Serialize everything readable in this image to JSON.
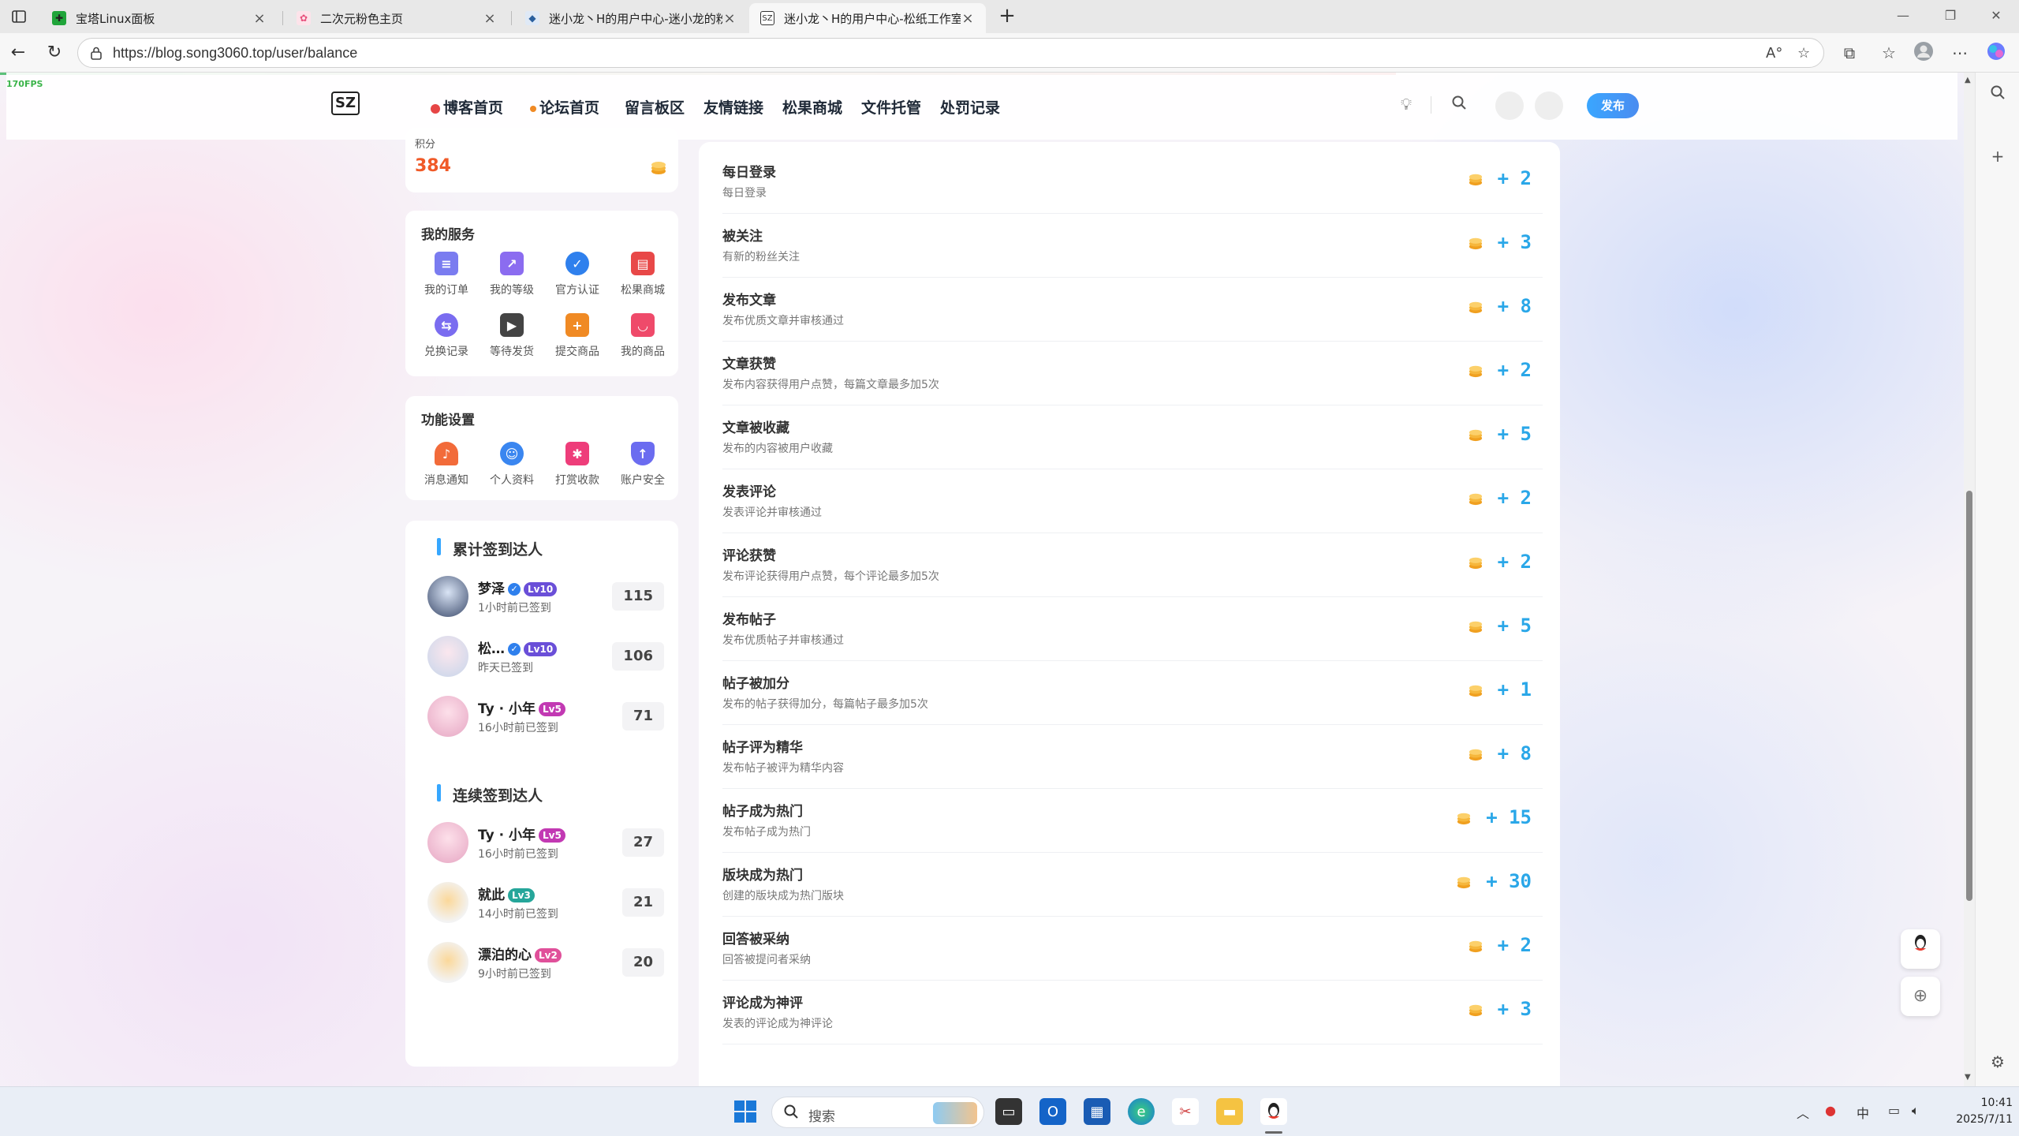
{
  "browser": {
    "tabs": [
      {
        "title": "宝塔Linux面板",
        "active": false
      },
      {
        "title": "二次元粉色主页",
        "active": false
      },
      {
        "title": "迷小龙丶H的用户中心-迷小龙的粉纸工作室",
        "active": false
      },
      {
        "title": "迷小龙丶H的用户中心-松纸工作室",
        "active": true
      }
    ],
    "url": "https://blog.song3060.top/user/balance"
  },
  "fps": "170FPS",
  "site": {
    "logo": "SZ",
    "nav": [
      "博客首页",
      "论坛首页",
      "留言板区",
      "友情链接",
      "松果商城",
      "文件托管",
      "处罚记录"
    ],
    "publish": "发布"
  },
  "sidebar": {
    "balance_label": "积分",
    "balance_value": "384",
    "services": {
      "title": "我的服务",
      "items": [
        "我的订单",
        "我的等级",
        "官方认证",
        "松果商城",
        "兑换记录",
        "等待发货",
        "提交商品",
        "我的商品"
      ]
    },
    "settings": {
      "title": "功能设置",
      "items": [
        "消息通知",
        "个人资料",
        "打赏收款",
        "账户安全"
      ]
    },
    "total_signin": {
      "title": "累计签到达人",
      "rows": [
        {
          "name": "梦泽",
          "level": "10",
          "time": "1小时前已签到",
          "count": "115"
        },
        {
          "name": "松…",
          "level": "10",
          "time": "昨天已签到",
          "count": "106"
        },
        {
          "name": "Ty · 小年",
          "level": "5",
          "time": "16小时前已签到",
          "count": "71"
        }
      ]
    },
    "streak_signin": {
      "title": "连续签到达人",
      "rows": [
        {
          "name": "Ty · 小年",
          "level": "5",
          "time": "16小时前已签到",
          "count": "27"
        },
        {
          "name": "就此",
          "level": "3",
          "time": "14小时前已签到",
          "count": "21"
        },
        {
          "name": "漂泊的心",
          "level": "2",
          "time": "9小时前已签到",
          "count": "20"
        }
      ]
    }
  },
  "points_rules": [
    {
      "title": "每日登录",
      "desc": "每日登录",
      "value": "+ 2"
    },
    {
      "title": "被关注",
      "desc": "有新的粉丝关注",
      "value": "+ 3"
    },
    {
      "title": "发布文章",
      "desc": "发布优质文章并审核通过",
      "value": "+ 8"
    },
    {
      "title": "文章获赞",
      "desc": "发布内容获得用户点赞，每篇文章最多加5次",
      "value": "+ 2"
    },
    {
      "title": "文章被收藏",
      "desc": "发布的内容被用户收藏",
      "value": "+ 5"
    },
    {
      "title": "发表评论",
      "desc": "发表评论并审核通过",
      "value": "+ 2"
    },
    {
      "title": "评论获赞",
      "desc": "发布评论获得用户点赞，每个评论最多加5次",
      "value": "+ 2"
    },
    {
      "title": "发布帖子",
      "desc": "发布优质帖子并审核通过",
      "value": "+ 5"
    },
    {
      "title": "帖子被加分",
      "desc": "发布的帖子获得加分，每篇帖子最多加5次",
      "value": "+ 1"
    },
    {
      "title": "帖子评为精华",
      "desc": "发布帖子被评为精华内容",
      "value": "+ 8"
    },
    {
      "title": "帖子成为热门",
      "desc": "发布帖子成为热门",
      "value": "+ 15"
    },
    {
      "title": "版块成为热门",
      "desc": "创建的版块成为热门版块",
      "value": "+ 30"
    },
    {
      "title": "回答被采纳",
      "desc": "回答被提问者采纳",
      "value": "+ 2"
    },
    {
      "title": "评论成为神评",
      "desc": "发表的评论成为神评论",
      "value": "+ 3"
    }
  ],
  "taskbar": {
    "search": "搜索",
    "ime": "中",
    "time": "10:41",
    "date": "2025/7/11"
  },
  "colors": {
    "accent": "#2aa7e8",
    "points": "#2aa7e8",
    "coin": "#f0a020"
  }
}
